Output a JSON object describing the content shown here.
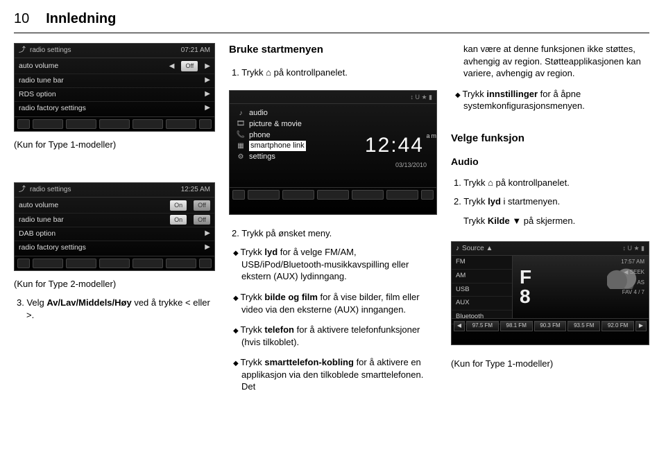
{
  "header": {
    "page": "10",
    "title": "Innledning"
  },
  "left": {
    "shot1": {
      "back_label": "radio settings",
      "time": "07:21 AM",
      "rows": [
        {
          "label": "auto volume",
          "value": "Off"
        },
        {
          "label": "radio tune bar"
        },
        {
          "label": "RDS option"
        },
        {
          "label": "radio factory settings"
        }
      ]
    },
    "note1": "(Kun for Type 1-modeller)",
    "shot2": {
      "back_label": "radio settings",
      "time": "12:25 AM",
      "rows": [
        {
          "label": "auto volume",
          "value_l": "On",
          "value_r": "Off"
        },
        {
          "label": "radio tune bar",
          "value_l": "On",
          "value_r": "Off"
        },
        {
          "label": "DAB option"
        },
        {
          "label": "radio factory settings"
        }
      ]
    },
    "note2": "(Kun for Type 2-modeller)",
    "step3": "3. Velg Av/Lav/Middels/Høy ved å trykke < eller >."
  },
  "mid": {
    "h1": "Bruke startmenyen",
    "step1": "1. Trykk ⌂ på kontrollpanelet.",
    "shot": {
      "menu": [
        {
          "icon": "♪",
          "label": "audio"
        },
        {
          "icon": "🎞",
          "label": "picture & movie"
        },
        {
          "icon": "📞",
          "label": "phone"
        },
        {
          "icon": "▦",
          "label": "smartphone link"
        },
        {
          "icon": "⚙",
          "label": "settings"
        }
      ],
      "clock": "12:44",
      "ampm": "am",
      "date": "03/13/2010"
    },
    "step2_lead": "2. Trykk på ønsket meny.",
    "b1": "Trykk lyd for å velge FM/AM, USB/iPod/Bluetooth-musikkavspilling eller ekstern (AUX) lydinngang.",
    "b2": "Trykk bilde og film for å vise bilder, film eller video via den eksterne (AUX) inngangen.",
    "b3": "Trykk telefon for å aktivere telefonfunksjoner (hvis tilkoblet).",
    "b4": "Trykk smarttelefon-kobling for å aktivere en applikasjon via den tilkoblede smarttelefonen. Det"
  },
  "right": {
    "p1": "kan være at denne funksjonen ikke støttes, avhengig av region. Støtteapplikasjonen kan variere, avhengig av region.",
    "b1": "Trykk innstillinger for å åpne systemkonfigurasjonsmenyen.",
    "h2": "Velge funksjon",
    "h3": "Audio",
    "s1": "1. Trykk ⌂ på kontrollpanelet.",
    "s2": "2. Trykk lyd i startmenyen.",
    "s3": "Trykk Kilde ▼ på skjermen.",
    "shot": {
      "src_label": "Source ▲",
      "tr": "↕ U ★ ▮",
      "side": [
        "FM",
        "AM",
        "USB",
        "AUX",
        "Bluetooth"
      ],
      "seek_l": "◀ SEEK",
      "as": "AS",
      "fav": "FAV 4 / 7",
      "presets": [
        "◀",
        "97.5 FM",
        "98.1 FM",
        "90.3 FM",
        "93.5 FM",
        "92.0 FM",
        "▶"
      ],
      "time": "17:57 AM"
    },
    "note": "(Kun for Type 1-modeller)"
  }
}
